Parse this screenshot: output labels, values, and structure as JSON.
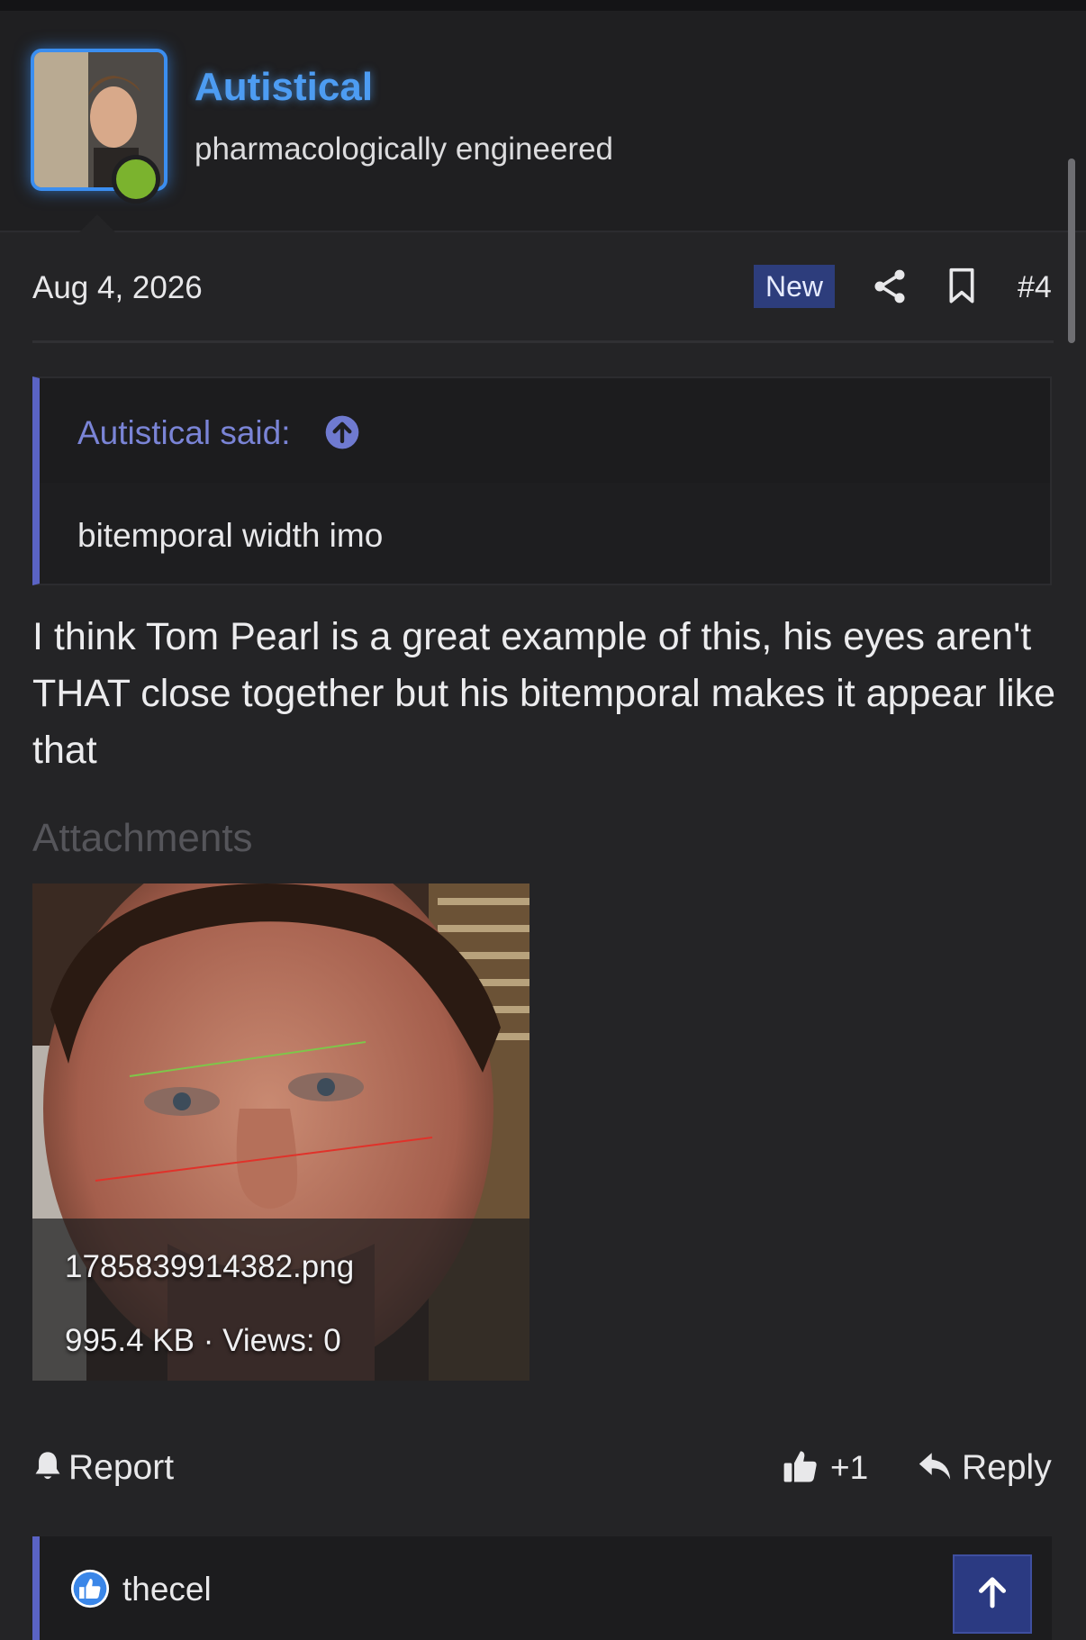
{
  "author": {
    "name": "Autistical",
    "title": "pharmacologically engineered",
    "status": "online"
  },
  "post": {
    "date": "Aug 4, 2026",
    "badge": "New",
    "number": "#4",
    "message": "I think Tom Pearl is a great example of this, his eyes aren't THAT close together but his bitemporal makes it appear like that"
  },
  "quote": {
    "author_label": "Autistical said:",
    "body": "bitemporal width imo"
  },
  "attachments": {
    "heading": "Attachments",
    "items": [
      {
        "filename": "1785839914382.png",
        "meta": "995.4 KB · Views: 0"
      }
    ]
  },
  "actions": {
    "report_label": "Report",
    "like_count": "+1",
    "reply_label": "Reply"
  },
  "reactions": {
    "users": [
      "thecel"
    ]
  },
  "icons": {
    "share": "share-icon",
    "bookmark": "bookmark-icon",
    "quote_jump": "arrow-up-circle-icon",
    "report": "bell-icon",
    "like": "thumbs-up-icon",
    "reply": "reply-arrow-icon",
    "reaction": "like-reaction-icon",
    "scroll_top": "arrow-up-icon"
  },
  "colors": {
    "background": "#242426",
    "username": "#4d9cf2",
    "quote_accent": "#5a63c4",
    "badge_bg": "#2d3d7c",
    "online": "#7bb32e"
  }
}
